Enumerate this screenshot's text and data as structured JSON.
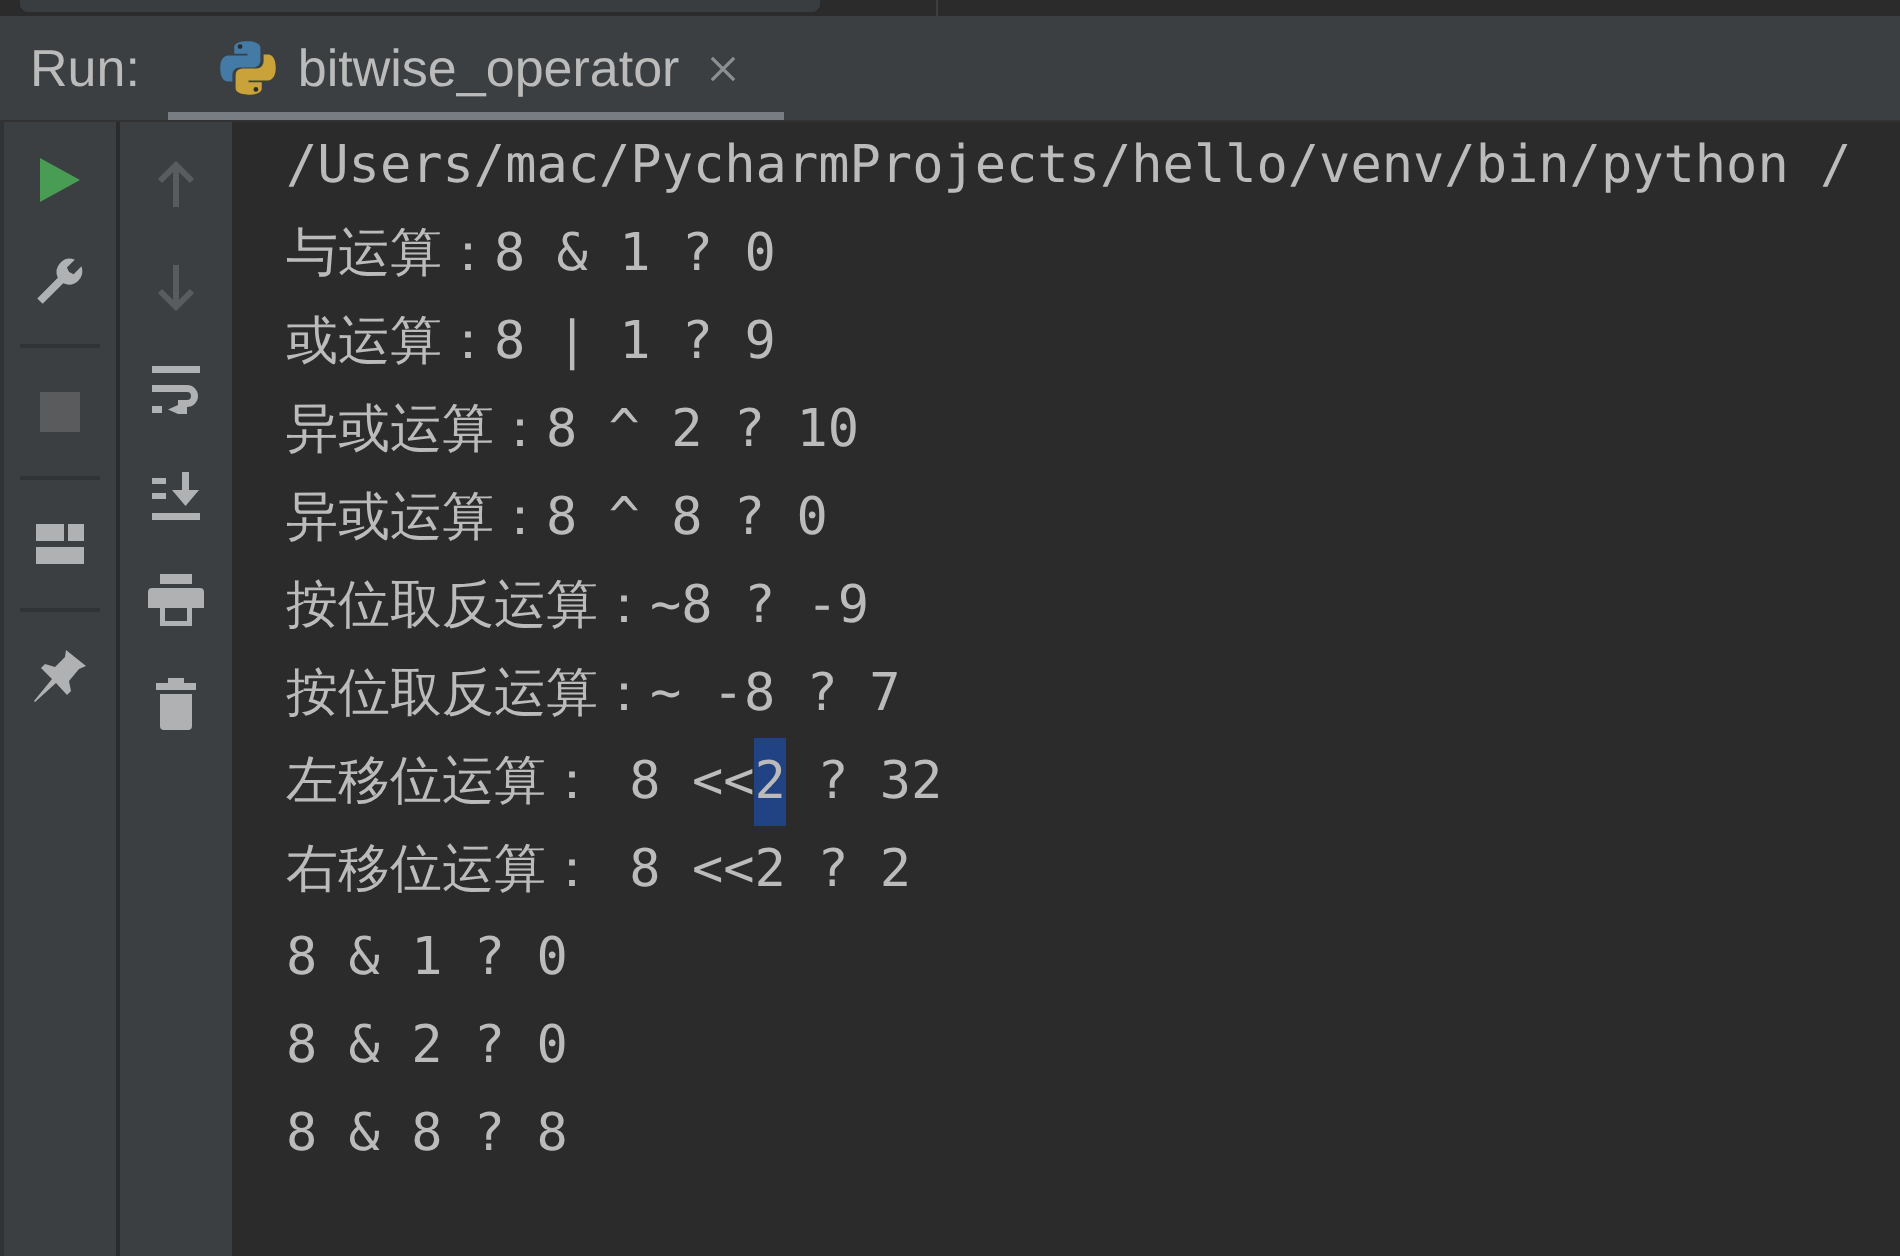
{
  "run_panel": {
    "label": "Run:",
    "tabs": [
      {
        "label": "bitwise_operator",
        "selected": true,
        "closable": true
      }
    ]
  },
  "run_toolbar": {
    "groups": [
      {
        "buttons": [
          {
            "kind": "run",
            "disabled": false
          },
          {
            "kind": "settings",
            "disabled": false
          }
        ]
      },
      {
        "buttons": [
          {
            "kind": "stop",
            "disabled": true
          }
        ]
      },
      {
        "buttons": [
          {
            "kind": "layout",
            "disabled": false
          }
        ]
      },
      {
        "buttons": [
          {
            "kind": "pin",
            "disabled": false
          }
        ]
      }
    ]
  },
  "output_toolbar": {
    "buttons": [
      {
        "kind": "up",
        "disabled": true
      },
      {
        "kind": "down",
        "disabled": true
      },
      {
        "kind": "wrap",
        "disabled": false
      },
      {
        "kind": "scroll_end",
        "disabled": false
      },
      {
        "kind": "print",
        "disabled": false
      },
      {
        "kind": "clear",
        "disabled": false
      }
    ]
  },
  "console": {
    "lines": [
      {
        "segments": [
          {
            "text": "/Users/mac/PycharmProjects/hello/venv/bin/python /",
            "selected": false
          }
        ]
      },
      {
        "segments": [
          {
            "text": "与运算：8 & 1 ? 0",
            "selected": false
          }
        ]
      },
      {
        "segments": [
          {
            "text": "或运算：8 | 1 ? 9",
            "selected": false
          }
        ]
      },
      {
        "segments": [
          {
            "text": "异或运算：8 ^ 2 ? 10",
            "selected": false
          }
        ]
      },
      {
        "segments": [
          {
            "text": "异或运算：8 ^ 8 ? 0",
            "selected": false
          }
        ]
      },
      {
        "segments": [
          {
            "text": "按位取反运算：~8 ? -9",
            "selected": false
          }
        ]
      },
      {
        "segments": [
          {
            "text": "按位取反运算：~ -8 ? 7",
            "selected": false
          }
        ]
      },
      {
        "segments": [
          {
            "text": "左移位运算： 8 <<",
            "selected": false
          },
          {
            "text": "2",
            "selected": true
          },
          {
            "text": " ? 32",
            "selected": false
          }
        ]
      },
      {
        "segments": [
          {
            "text": "右移位运算： 8 <<2 ? 2",
            "selected": false
          }
        ]
      },
      {
        "segments": [
          {
            "text": "8 & 1 ? 0",
            "selected": false
          }
        ]
      },
      {
        "segments": [
          {
            "text": "8 & 2 ? 0",
            "selected": false
          }
        ]
      },
      {
        "segments": [
          {
            "text": "8 & 8 ? 8",
            "selected": false
          }
        ]
      }
    ]
  }
}
